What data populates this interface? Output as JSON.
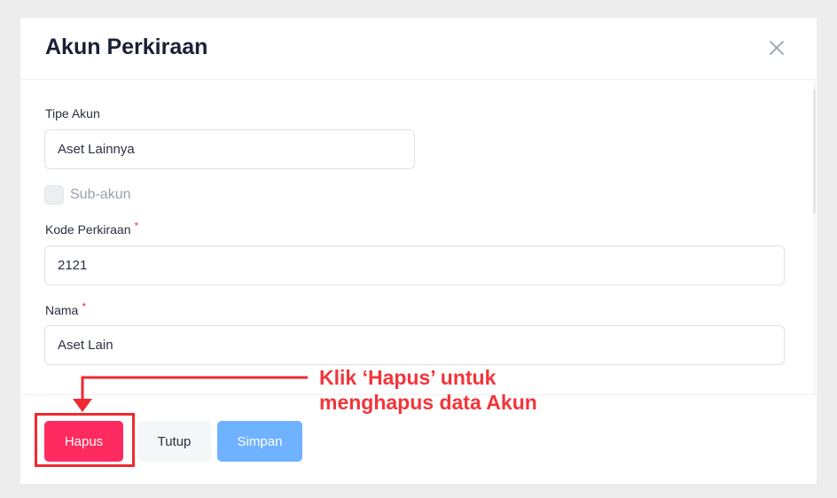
{
  "modal": {
    "title": "Akun Perkiraan",
    "close_icon": "close-icon"
  },
  "form": {
    "account_type": {
      "label": "Tipe Akun",
      "value": "Aset Lainnya"
    },
    "sub_account": {
      "label": "Sub-akun",
      "checked": false
    },
    "account_code": {
      "label": "Kode Perkiraan",
      "required_mark": "*",
      "value": "2121"
    },
    "name": {
      "label": "Nama",
      "required_mark": "*",
      "value": "Aset Lain"
    }
  },
  "footer": {
    "delete_label": "Hapus",
    "close_label": "Tutup",
    "save_label": "Simpan"
  },
  "annotation": {
    "line1": "Klik ‘Hapus’ untuk",
    "line2": "menghapus data Akun",
    "color": "#f2353a"
  },
  "colors": {
    "delete": "#ff2a5f",
    "save": "#6fb2ff",
    "required": "#e5344f"
  }
}
